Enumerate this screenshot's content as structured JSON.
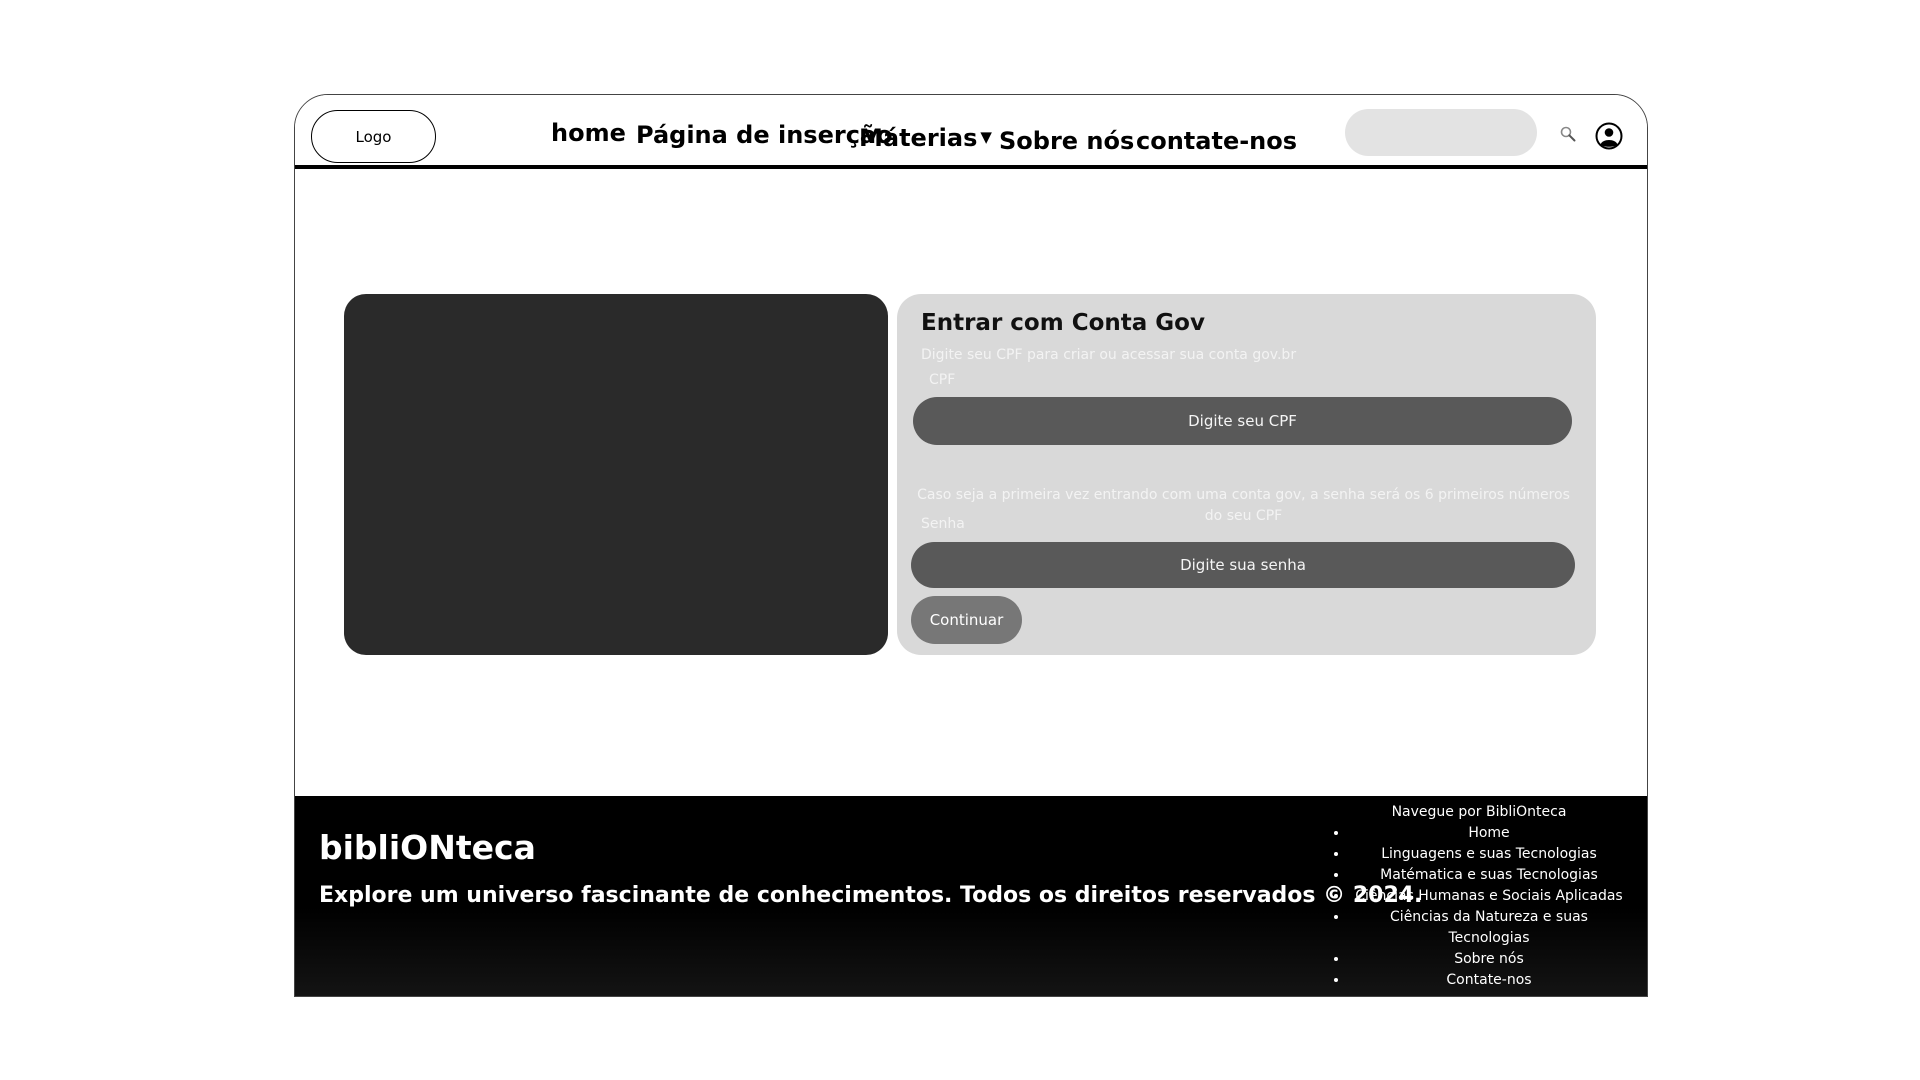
{
  "header": {
    "logo_label": "Logo",
    "nav": {
      "home": "home",
      "insert_page": "Página de inserção",
      "materias": "Máterias",
      "materias_caret": "▼",
      "sobre": "Sobre nós",
      "contate": "contate-nos"
    },
    "search_placeholder": ""
  },
  "login": {
    "title": "Entrar com Conta Gov",
    "subtitle": "Digite seu CPF para criar ou acessar sua conta gov.br",
    "cpf_label": "CPF",
    "cpf_placeholder": "Digite seu CPF",
    "password_hint": "Caso seja a primeira vez entrando com uma conta gov, a senha será os 6 primeiros números do seu CPF",
    "password_label": "Senha",
    "password_placeholder": "Digite sua senha",
    "continue_label": "Continuar"
  },
  "footer": {
    "brand": "bibliONteca",
    "tagline": "Explore um universo fascinante de conhecimentos. Todos os direitos reservados © 2024.",
    "nav_title": "Navegue por BibliOnteca",
    "links": [
      "Home",
      "Linguagens e suas Tecnologias",
      "Matématica e suas Tecnologias",
      "Ciências Humanas e Sociais Aplicadas",
      "Ciências da Natureza e suas Tecnologias",
      "Sobre nós",
      "Contate-nos"
    ]
  },
  "colors": {
    "media_panel": "#2a2a2a",
    "card_background": "#d9d9d9",
    "input_background": "#595959",
    "button_background": "#777777",
    "footer_background": "#000000"
  }
}
